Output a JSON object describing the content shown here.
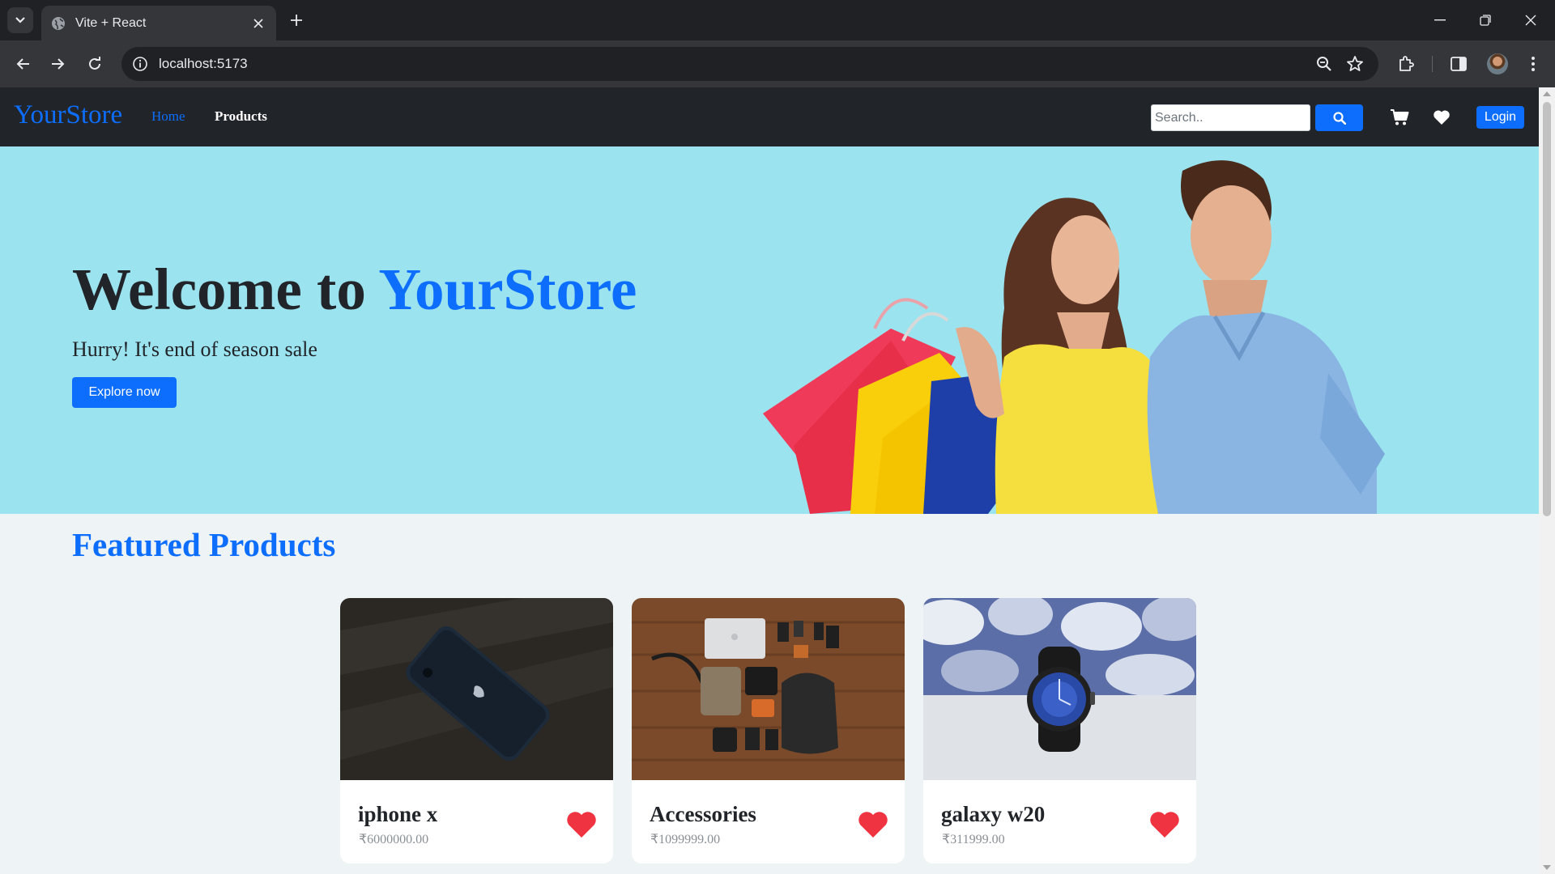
{
  "browser": {
    "tab_title": "Vite + React",
    "url": "localhost:5173"
  },
  "navbar": {
    "brand": "YourStore",
    "links": [
      {
        "label": "Home",
        "active": true
      },
      {
        "label": "Products",
        "active": false
      }
    ],
    "search_placeholder": "Search..",
    "login_label": "Login"
  },
  "hero": {
    "title_prefix": "Welcome to ",
    "title_accent": "YourStore",
    "subtitle": "Hurry! It's end of season sale",
    "cta_label": "Explore now"
  },
  "featured": {
    "title": "Featured Products",
    "products": [
      {
        "name": "iphone x",
        "price": "₹6000000.00"
      },
      {
        "name": "Accessories",
        "price": "₹1099999.00"
      },
      {
        "name": "galaxy w20",
        "price": "₹311999.00"
      }
    ]
  },
  "colors": {
    "accent": "#0d6efd",
    "navbar_bg": "#212529",
    "hero_bg": "#9ae3ef",
    "page_bg": "#eef3f5",
    "heart": "#ef3340"
  },
  "icons": [
    "tab-search-icon",
    "globe-icon",
    "close-icon",
    "plus-icon",
    "minimize-icon",
    "restore-icon",
    "window-close-icon",
    "back-icon",
    "forward-icon",
    "reload-icon",
    "site-info-icon",
    "zoom-icon",
    "star-icon",
    "extensions-icon",
    "side-panel-icon",
    "menu-icon",
    "search-icon",
    "cart-icon",
    "heart-icon"
  ]
}
